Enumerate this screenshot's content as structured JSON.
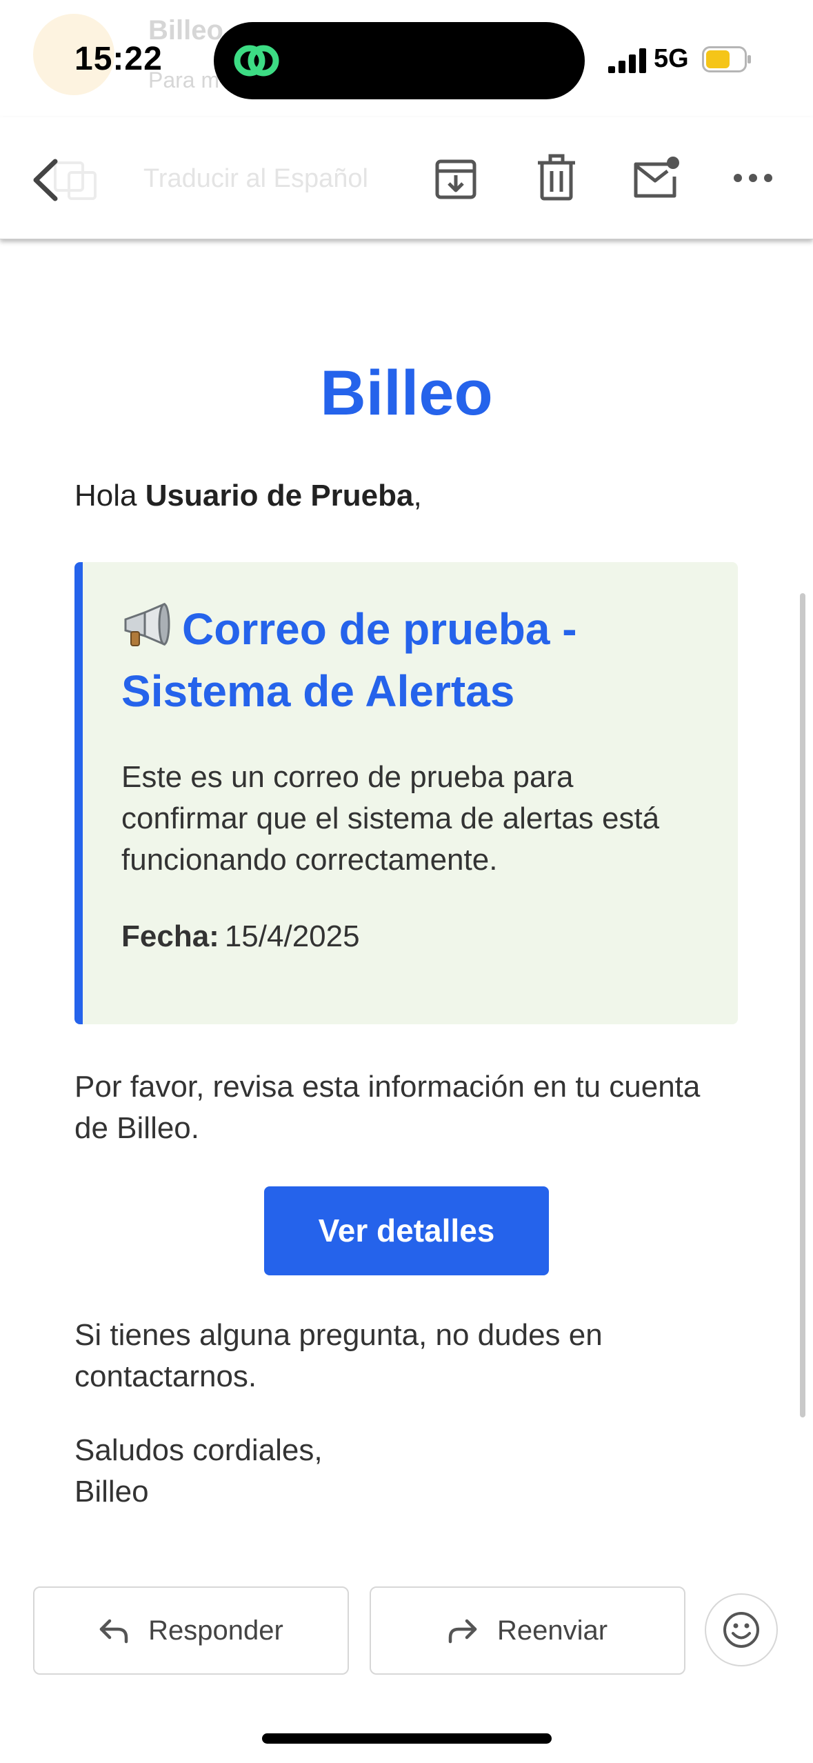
{
  "status_bar": {
    "time": "15:22",
    "network": "5G"
  },
  "background_header": {
    "sender": "Billeo",
    "to": "Para m"
  },
  "toolbar": {
    "translate_label": "Traducir al Español",
    "back_icon": "chevron-left-icon",
    "archive_icon": "archive-icon",
    "delete_icon": "trash-icon",
    "unread_icon": "mark-unread-icon",
    "more_icon": "more-horizontal-icon"
  },
  "email": {
    "brand": "Billeo",
    "greeting_prefix": "Hola ",
    "greeting_name": "Usuario de Prueba",
    "greeting_suffix": ",",
    "alert": {
      "icon": "megaphone-icon",
      "title": "Correo de prueba - Sistema de Alertas",
      "body": "Este es un correo de prueba para confirmar que el sistema de alertas está funcionando correctamente.",
      "date_label": "Fecha:",
      "date_value": "15/4/2025"
    },
    "review_text": "Por favor, revisa esta información en tu cuenta de Billeo.",
    "cta_label": "Ver detalles",
    "questions_text": "Si tienes alguna pregunta, no dudes en contactarnos.",
    "signoff_line1": "Saludos cordiales,",
    "signoff_line2": "Billeo"
  },
  "actions": {
    "reply_label": "Responder",
    "forward_label": "Reenviar",
    "emoji_icon": "emoji-smile-icon"
  },
  "colors": {
    "accent": "#2563eb",
    "alert_background": "#f0f6ea",
    "island_icon": "#3ddc84",
    "battery": "#f5c518"
  }
}
